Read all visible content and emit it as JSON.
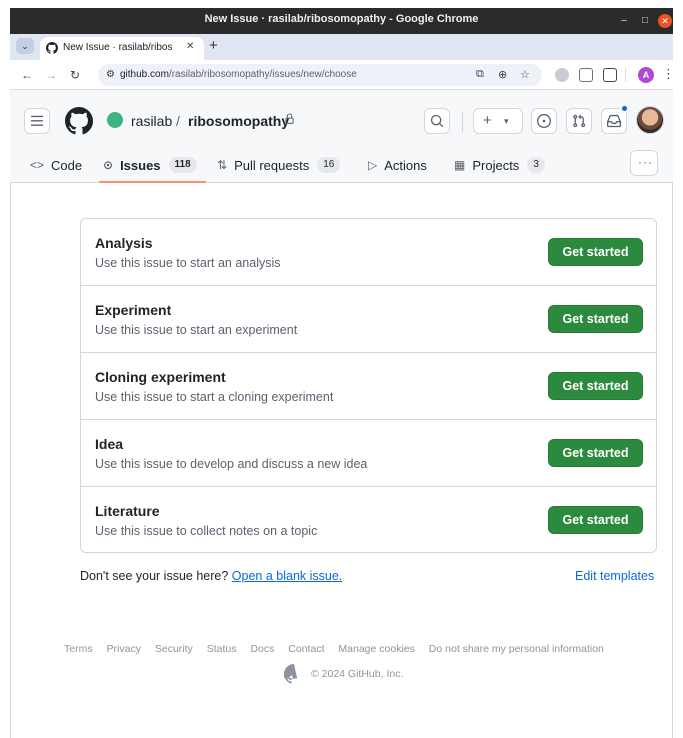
{
  "window": {
    "title": "New Issue · rasilab/ribosomopathy - Google Chrome"
  },
  "browser": {
    "tab_title": "New Issue · rasilab/ribos",
    "url_domain": "github.com",
    "url_path": "/rasilab/ribosomopathy/issues/new/choose",
    "profile_initial": "A"
  },
  "repo": {
    "owner": "rasilab",
    "separator": "/",
    "name": "ribosomopathy"
  },
  "nav": {
    "code": "Code",
    "issues": "Issues",
    "issues_count": "118",
    "pull_requests": "Pull requests",
    "pull_requests_count": "16",
    "actions": "Actions",
    "projects": "Projects",
    "projects_count": "3"
  },
  "templates": [
    {
      "name": "Analysis",
      "description": "Use this issue to start an analysis",
      "button": "Get started"
    },
    {
      "name": "Experiment",
      "description": "Use this issue to start an experiment",
      "button": "Get started"
    },
    {
      "name": "Cloning experiment",
      "description": "Use this issue to start a cloning experiment",
      "button": "Get started"
    },
    {
      "name": "Idea",
      "description": "Use this issue to develop and discuss a new idea",
      "button": "Get started"
    },
    {
      "name": "Literature",
      "description": "Use this issue to collect notes on a topic",
      "button": "Get started"
    }
  ],
  "bottom": {
    "dont_see": "Don't see your issue here?",
    "blank_issue": "Open a blank issue.",
    "edit_templates": "Edit templates"
  },
  "footer": {
    "links": [
      "Terms",
      "Privacy",
      "Security",
      "Status",
      "Docs",
      "Contact",
      "Manage cookies",
      "Do not share my personal information"
    ],
    "copyright": "© 2024 GitHub, Inc."
  },
  "colors": {
    "primary_button": "#2c8a3f",
    "link": "#0969da",
    "active_tab_underline": "#fd8c73",
    "notification_dot": "#0969da"
  },
  "icons": [
    "github-logo-icon",
    "hamburger-icon",
    "lock-icon",
    "search-icon",
    "plus-icon",
    "issue-icon",
    "pull-request-icon",
    "inbox-icon",
    "code-icon",
    "play-icon",
    "table-icon",
    "more-icon"
  ]
}
